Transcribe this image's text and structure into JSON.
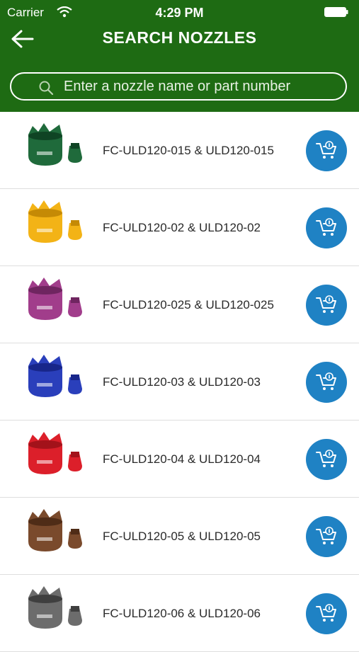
{
  "status": {
    "carrier": "Carrier",
    "time": "4:29 PM"
  },
  "header": {
    "title": "SEARCH NOZZLES"
  },
  "search": {
    "placeholder": "Enter a nozzle name or part number"
  },
  "colors": {
    "header": "#1e6b13",
    "cart": "#1f82c4"
  },
  "items": [
    {
      "name": "FC-ULD120-015 & ULD120-015",
      "color": "#1f6a3b",
      "dark": "#0f4424",
      "icon": "cart-icon"
    },
    {
      "name": "FC-ULD120-02 & ULD120-02",
      "color": "#f3b316",
      "dark": "#c58a05",
      "icon": "cart-icon"
    },
    {
      "name": "FC-ULD120-025 & ULD120-025",
      "color": "#a13d8b",
      "dark": "#6f2560",
      "icon": "cart-icon"
    },
    {
      "name": "FC-ULD120-03 & ULD120-03",
      "color": "#2a3fbb",
      "dark": "#18268a",
      "icon": "cart-icon"
    },
    {
      "name": "FC-ULD120-04 & ULD120-04",
      "color": "#dc1f2a",
      "dark": "#a3121a",
      "icon": "cart-icon"
    },
    {
      "name": "FC-ULD120-05 & ULD120-05",
      "color": "#7a4a2c",
      "dark": "#4f2c17",
      "icon": "cart-icon"
    },
    {
      "name": "FC-ULD120-06 & ULD120-06",
      "color": "#6c6c6c",
      "dark": "#3f3f3f",
      "icon": "cart-icon"
    }
  ]
}
